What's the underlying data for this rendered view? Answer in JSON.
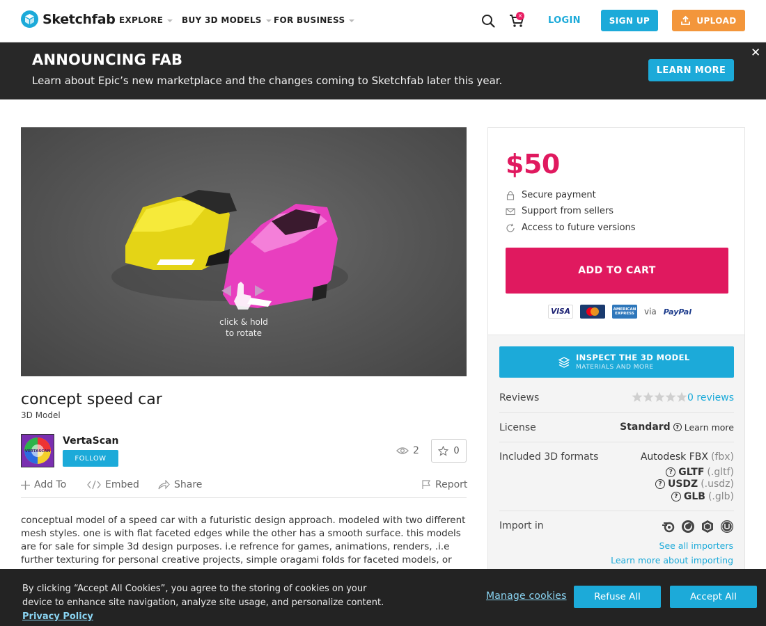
{
  "nav": {
    "brand": "Sketchfab",
    "menus": [
      "EXPLORE",
      "BUY 3D MODELS",
      "FOR BUSINESS"
    ],
    "cart_count": "×",
    "login": "LOGIN",
    "signup": "SIGN UP",
    "upload": "UPLOAD"
  },
  "announcement": {
    "title": "ANNOUNCING FAB",
    "text": "Learn about Epic’s new marketplace and the changes coming to Sketchfab later this year.",
    "button": "LEARN MORE",
    "close": "✕"
  },
  "viewer": {
    "hint_line1": "click & hold",
    "hint_line2": "to rotate"
  },
  "model": {
    "title": "concept speed car",
    "subtitle": "3D Model",
    "author": "VertaScan",
    "follow": "FOLLOW",
    "views": "2",
    "likes": "0",
    "avatar_text": "VERTASCAN"
  },
  "actions": {
    "add_to": "Add To",
    "embed": "Embed",
    "share": "Share",
    "report": "Report"
  },
  "description": "conceptual model of a speed car with a futuristic design approach. modeled with two different mesh styles. one is with flat faceted edges while the other has a smooth surface. this models are for sale for simple 3d design purposes. i.e refrence for games, animations, renders, .i.e further texturing for personal creative projects, simple oragami folds for faceted models, or",
  "purchase": {
    "price": "$50",
    "perks": [
      "Secure payment",
      "Support from sellers",
      "Access to future versions"
    ],
    "add_to_cart": "ADD TO CART",
    "cards": [
      "VISA",
      "",
      "AMERICAN EXPRESS"
    ],
    "via": "via",
    "paypal": "PayPal"
  },
  "info": {
    "inspect_title": "INSPECT THE 3D MODEL",
    "inspect_sub": "MATERIALS AND MORE",
    "reviews_label": "Reviews",
    "reviews_link": "0 reviews",
    "rating": 0,
    "license_label": "License",
    "license_value": "Standard",
    "license_learn": "Learn more",
    "formats_label": "Included 3D formats",
    "formats": [
      {
        "name": "Autodesk FBX",
        "ext": "(fbx)"
      },
      {
        "name": "GLTF",
        "ext": "(.gltf)"
      },
      {
        "name": "USDZ",
        "ext": "(.usdz)"
      },
      {
        "name": "GLB",
        "ext": "(.glb)"
      }
    ],
    "import_label": "Import in",
    "importer_icons": [
      "blender-icon",
      "cinema4d-icon",
      "unity-icon",
      "unreal-icon"
    ],
    "see_importers": "See all importers",
    "learn_importing": "Learn more about importing"
  },
  "cookies": {
    "text": "By clicking “Accept All Cookies”, you agree to the storing of cookies on your device to enhance site navigation, analyze site usage, and personalize content.",
    "privacy": "Privacy Policy",
    "manage": "Manage cookies",
    "refuse": "Refuse All",
    "accept": "Accept All"
  },
  "colors": {
    "accent": "#1caad9",
    "price": "#e0195f",
    "upload": "#f3963b"
  }
}
